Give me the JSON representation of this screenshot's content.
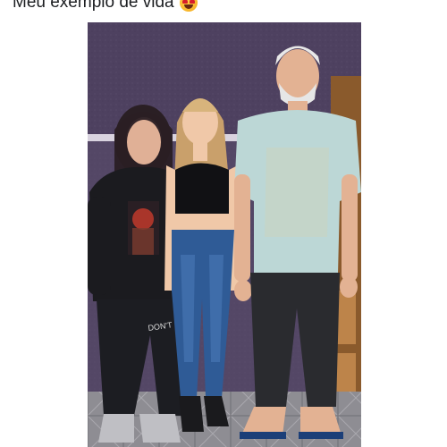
{
  "post": {
    "caption": "Meu exemplo de vida",
    "emoji": "heart-eyes-emoji"
  },
  "photo": {
    "description_icon": "family-photo",
    "shirt_text": "DON'T"
  },
  "colors": {
    "background": "#ffffff",
    "wall": "#4e4160",
    "wall_dark": "#3f3450",
    "baseboard": "#e9e4ec",
    "floor": "#8f8f94",
    "door": "#8a5a2c",
    "caption_text": "#1c1e21"
  }
}
